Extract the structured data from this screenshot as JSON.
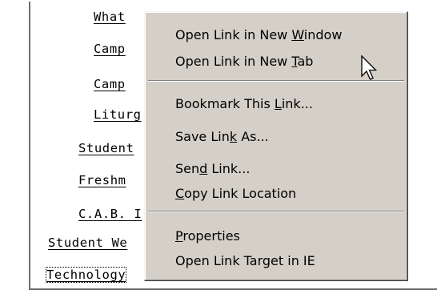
{
  "links": [
    {
      "text": "What"
    },
    {
      "text": "Camp"
    },
    {
      "text": "Camp"
    },
    {
      "text": "Liturg"
    },
    {
      "text": "Student"
    },
    {
      "text": "Freshm"
    },
    {
      "text": "C.A.B. I"
    },
    {
      "text": "Student We"
    },
    {
      "text": "Technology"
    }
  ],
  "context_menu": {
    "items": [
      {
        "before": "Open Link in New ",
        "mnemonic": "W",
        "after": "indow"
      },
      {
        "before": "Open Link in New ",
        "mnemonic": "T",
        "after": "ab"
      },
      {
        "before": "Bookmark This ",
        "mnemonic": "L",
        "after": "ink..."
      },
      {
        "before": "Save Lin",
        "mnemonic": "k",
        "after": " As..."
      },
      {
        "before": "Sen",
        "mnemonic": "d",
        "after": " Link..."
      },
      {
        "before": "",
        "mnemonic": "C",
        "after": "opy Link Location"
      },
      {
        "before": "",
        "mnemonic": "P",
        "after": "roperties"
      },
      {
        "before": "Open Link Target in IE",
        "mnemonic": "",
        "after": ""
      }
    ]
  },
  "cursor": {
    "icon": "arrow-pointer-icon"
  }
}
